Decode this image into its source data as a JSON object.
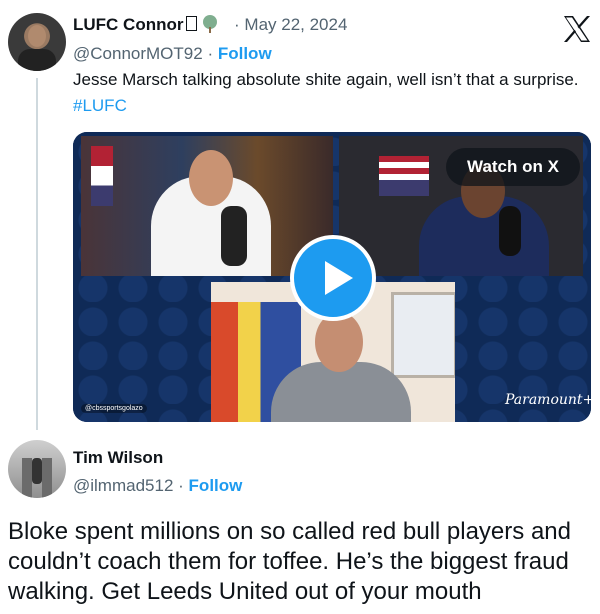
{
  "tweet": {
    "author_name": "LUFC Connor",
    "handle": "@ConnorMOT92",
    "date": "May 22, 2024",
    "follow_label": "Follow",
    "text": "Jesse Marsch talking absolute shite again, well isn’t that a surprise.",
    "hashtag": "#LUFC",
    "media": {
      "watch_label": "Watch on X",
      "watermark": "Paramount+",
      "channel_tag": "@cbssportsgolazo"
    }
  },
  "reply": {
    "author_name": "Tim Wilson",
    "handle": "@ilmmad512",
    "follow_label": "Follow",
    "text": "Bloke spent millions on so called red bull players and couldn’t coach them for toffee. He’s the biggest fraud walking. Get Leeds United out of your mouth"
  },
  "separator": "·",
  "colors": {
    "link": "#1d9bf0",
    "text": "#0f1419",
    "muted": "#536471"
  },
  "icons": [
    "x-logo-icon",
    "play-icon",
    "tree-emoji-icon"
  ]
}
